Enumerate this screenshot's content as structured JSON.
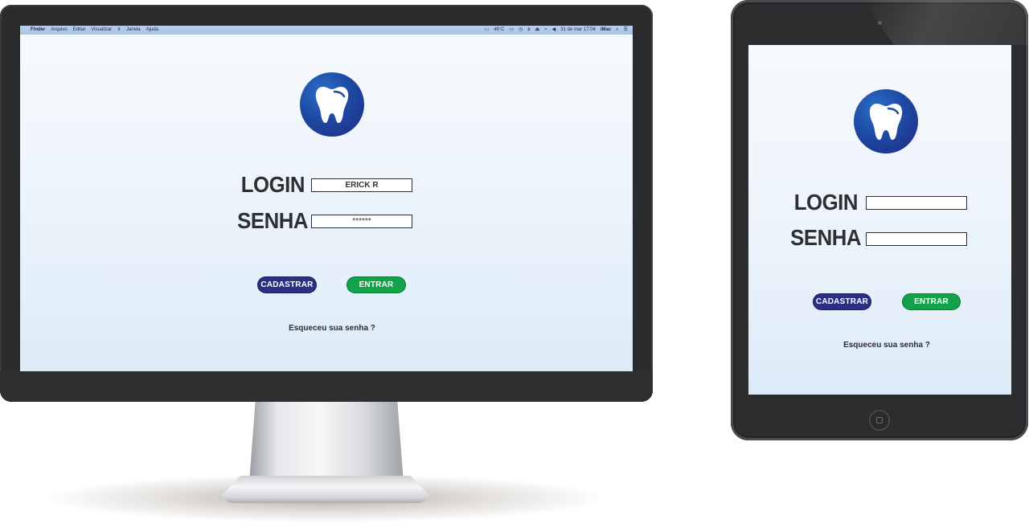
{
  "desktop": {
    "menubar": {
      "apple": "",
      "items": [
        "Finder",
        "Arquivo",
        "Editar",
        "Visualizar",
        "Ir",
        "Janela",
        "Ajuda"
      ],
      "status": [
        "46°C",
        "31 de mar 17:04",
        "iMac"
      ]
    },
    "app": {
      "login_label": "LOGIN",
      "login_value": "ERICK R",
      "senha_label": "SENHA",
      "senha_value": "******",
      "cadastrar_label": "CADASTRAR",
      "entrar_label": "ENTRAR",
      "forgot_label": "Esqueceu sua senha ?"
    },
    "stand_logo": ""
  },
  "tablet": {
    "app": {
      "login_label": "LOGIN",
      "login_value": "",
      "senha_label": "SENHA",
      "senha_value": "",
      "cadastrar_label": "CADASTRAR",
      "entrar_label": "ENTRAR",
      "forgot_label": "Esqueceu sua senha ?"
    }
  },
  "icons": {
    "logo": "tooth-icon",
    "apple": "apple-icon"
  },
  "colors": {
    "logo_blue": "#1e4aa3",
    "cadastrar_bg": "#2b2f86",
    "entrar_bg": "#11a24a",
    "screen_bg": "#ecf4fb",
    "device_frame": "#2a2b2d"
  }
}
